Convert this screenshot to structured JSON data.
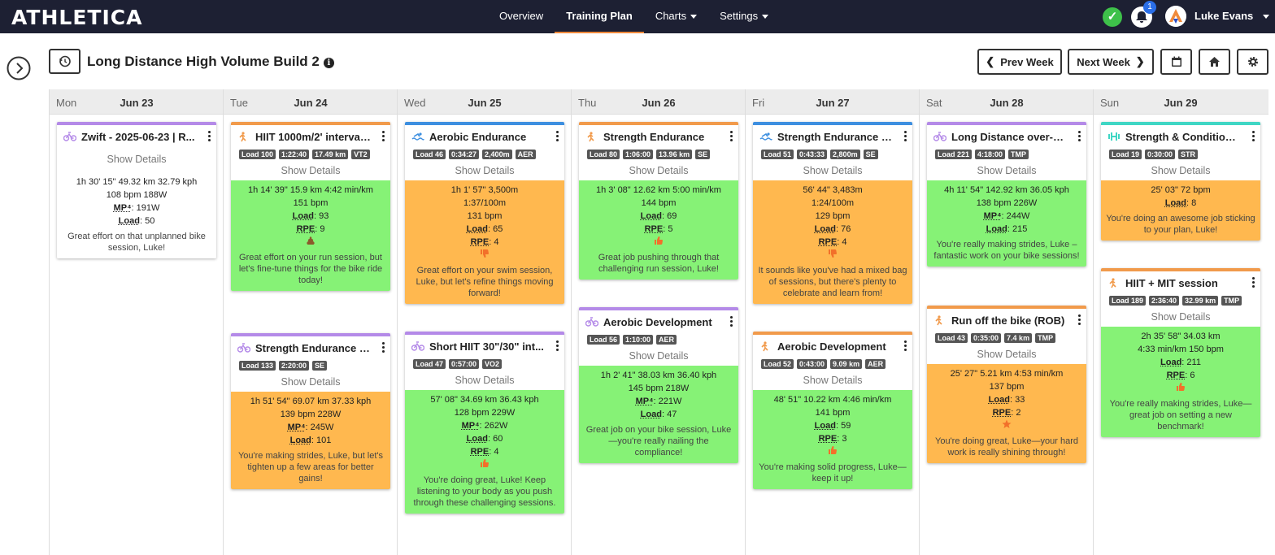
{
  "nav": {
    "logo": "ATHLETICA",
    "links": [
      "Overview",
      "Training Plan",
      "Charts",
      "Settings"
    ],
    "notifications": "1",
    "user": "Luke Evans"
  },
  "plan": {
    "title": "Long Distance High Volume Build 2",
    "prev": "Prev Week",
    "next": "Next Week"
  },
  "days": [
    {
      "dow": "Mon",
      "date": "Jun 23"
    },
    {
      "dow": "Tue",
      "date": "Jun 24"
    },
    {
      "dow": "Wed",
      "date": "Jun 25"
    },
    {
      "dow": "Thu",
      "date": "Jun 26"
    },
    {
      "dow": "Fri",
      "date": "Jun 27"
    },
    {
      "dow": "Sat",
      "date": "Jun 28"
    },
    {
      "dow": "Sun",
      "date": "Jun 29"
    }
  ],
  "common": {
    "show_details": "Show Details",
    "load": "Load",
    "rpe": "RPE",
    "mp4": "MP⁴"
  },
  "cards": {
    "mon1": {
      "title": "Zwift - 2025-06-23 | R...",
      "r1": "1h 30' 15\"   49.32 km   32.79 kph",
      "r2": "108 bpm   188W",
      "mp": "191W",
      "load": "50",
      "msg": "Great effort on that unplanned bike session, Luke!"
    },
    "tue1": {
      "title": "HIIT 1000m/2' interval r...",
      "tags": [
        "Load 100",
        "1:22:40",
        "17.49 km",
        "VT2"
      ],
      "r1": "1h 14' 39\"   15.9 km   4:42 min/km",
      "r2": "151 bpm",
      "load": "93",
      "rpe": "9",
      "msg": "Great effort on your run session, but let's fine-tune things for the bike ride today!"
    },
    "tue2": {
      "title": "Strength Endurance - ...",
      "tags": [
        "Load 133",
        "2:20:00",
        "SE"
      ],
      "r1": "1h 51' 54\"   69.07 km   37.33 kph",
      "r2": "139 bpm   228W",
      "mp": "245W",
      "load": "101",
      "msg": "You're making strides, Luke, but let's tighten up a few areas for better gains!"
    },
    "wed1": {
      "title": "Aerobic Endurance",
      "tags": [
        "Load 46",
        "0:34:27",
        "2,400m",
        "AER"
      ],
      "r1": "1h 1' 57\"   3,500m",
      "r2": "1:37/100m",
      "r3": "131 bpm",
      "load": "65",
      "rpe": "4",
      "msg": "Great effort on your swim session, Luke, but let's refine things moving forward!"
    },
    "wed2": {
      "title": "Short HIIT 30\"/30\" int...",
      "tags": [
        "Load 47",
        "0:57:00",
        "VO2"
      ],
      "r1": "57' 08\"   34.69 km   36.43 kph",
      "r2": "128 bpm   229W",
      "mp": "262W",
      "load": "60",
      "rpe": "4",
      "msg": "You're doing great, Luke! Keep listening to your body as you push through these challenging sessions."
    },
    "thu1": {
      "title": "Strength Endurance",
      "tags": [
        "Load 80",
        "1:06:00",
        "13.96 km",
        "SE"
      ],
      "r1": "1h 3' 08\"   12.62 km   5:00 min/km",
      "r2": "144 bpm",
      "load": "69",
      "rpe": "5",
      "msg": "Great job pushing through that challenging run session, Luke!"
    },
    "thu2": {
      "title": "Aerobic Development",
      "tags": [
        "Load 56",
        "1:10:00",
        "AER"
      ],
      "r1": "1h 2' 41\"   38.03 km   36.40 kph",
      "r2": "145 bpm   218W",
      "mp": "221W",
      "load": "47",
      "msg": "Great job on your bike session, Luke—you're really nailing the compliance!"
    },
    "fri1": {
      "title": "Strength Endurance (SE)",
      "tags": [
        "Load 51",
        "0:43:33",
        "2,800m",
        "SE"
      ],
      "r1": "56' 44\"   3,483m",
      "r2": "1:24/100m",
      "r3": "129 bpm",
      "load": "76",
      "rpe": "4",
      "msg": "It sounds like you've had a mixed bag of sessions, but there's plenty to celebrate and learn from!"
    },
    "fri2": {
      "title": "Aerobic Development",
      "tags": [
        "Load 52",
        "0:43:00",
        "9.09 km",
        "AER"
      ],
      "r1": "48' 51\"   10.22 km   4:46 min/km",
      "r2": "141 bpm",
      "load": "59",
      "rpe": "3",
      "msg": "You're making solid progress, Luke—keep it up!"
    },
    "sat1": {
      "title": "Long Distance over-un...",
      "tags": [
        "Load 221",
        "4:18:00",
        "TMP"
      ],
      "r1": "4h 11' 54\"   142.92 km   36.05 kph",
      "r2": "138 bpm   226W",
      "mp": "244W",
      "load": "215",
      "msg": "You're really making strides, Luke – fantastic work on your bike sessions!"
    },
    "sat2": {
      "title": "Run off the bike (ROB)",
      "tags": [
        "Load 43",
        "0:35:00",
        "7.4 km",
        "TMP"
      ],
      "r1": "25' 27\"   5.21 km   4:53 min/km",
      "r2": "137 bpm",
      "load": "33",
      "rpe": "2",
      "msg": "You're doing great, Luke—your hard work is really shining through!"
    },
    "sun1": {
      "title": "Strength & Conditionin...",
      "tags": [
        "Load 19",
        "0:30:00",
        "STR"
      ],
      "r1": "25' 03\"   72 bpm",
      "load": "8",
      "msg": "You're doing an awesome job sticking to your plan, Luke!"
    },
    "sun2": {
      "title": "HIIT + MIT session",
      "tags": [
        "Load 189",
        "2:36:40",
        "32.99 km",
        "TMP"
      ],
      "r1": "2h 35' 58\"   34.03 km",
      "r2": "4:33 min/km   150 bpm",
      "load": "211",
      "rpe": "6",
      "msg": "You're really making strides, Luke—great job on setting a new benchmark!"
    }
  },
  "colors": {
    "nav": "#1d2033",
    "green": "#86f276",
    "orange": "#ffb84f",
    "bike": "#b48ae8",
    "run": "#f19a4b",
    "swim": "#3d8fe0",
    "strength": "#3fd6c4"
  }
}
